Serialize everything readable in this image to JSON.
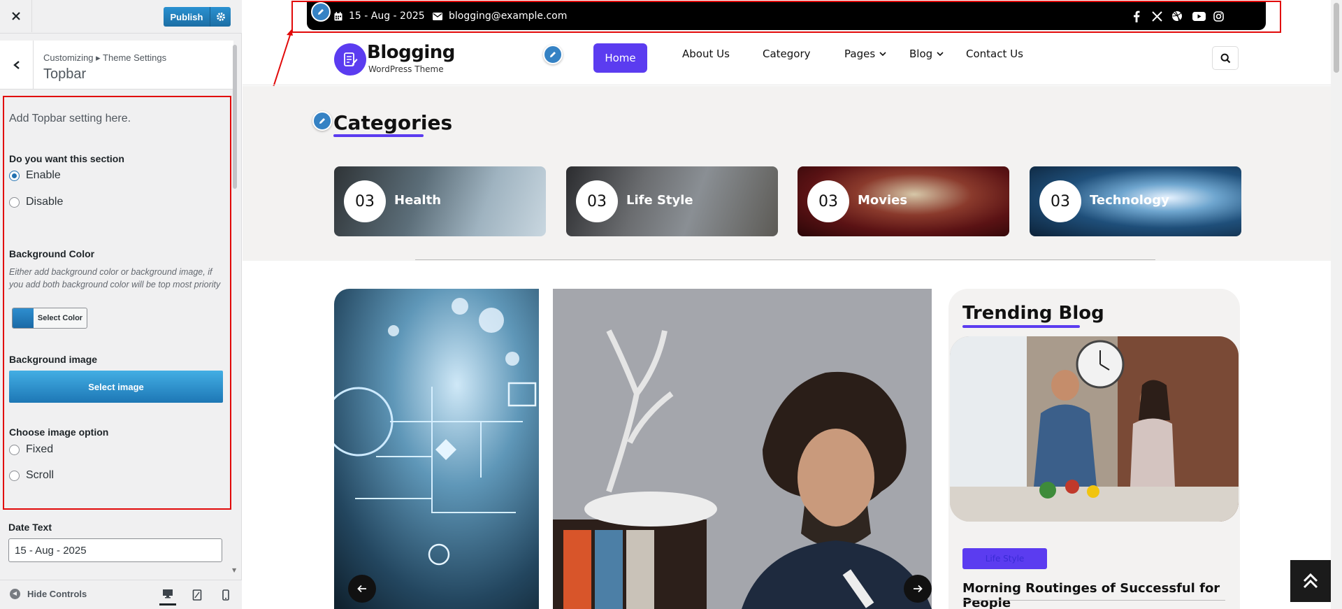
{
  "customizer": {
    "publish_label": "Publish",
    "breadcrumb": "Customizing ▸ Theme Settings",
    "section_title": "Topbar",
    "description": "Add Topbar setting here.",
    "section_toggle": {
      "label": "Do you want this section",
      "options": [
        "Enable",
        "Disable"
      ],
      "selected": "Enable"
    },
    "background_color": {
      "label": "Background Color",
      "hint": "Either add background color or background image, if you add both background color will be top most priority",
      "button_label": "Select Color",
      "swatch": "#2a8acb"
    },
    "background_image": {
      "label": "Background image",
      "button_label": "Select image"
    },
    "image_option": {
      "label": "Choose image option",
      "options": [
        "Fixed",
        "Scroll"
      ]
    },
    "date_text": {
      "label": "Date Text",
      "value": "15 - Aug - 2025"
    },
    "footer": {
      "hide_controls": "Hide Controls",
      "devices": [
        "desktop",
        "tablet",
        "mobile"
      ],
      "active_device": "desktop"
    }
  },
  "site": {
    "topbar": {
      "date": "15 - Aug - 2025",
      "email": "blogging@example.com",
      "social": [
        "facebook-icon",
        "x-icon",
        "dribbble-icon",
        "youtube-icon",
        "instagram-icon"
      ]
    },
    "logo": {
      "name": "Blogging",
      "tagline": "WordPress Theme"
    },
    "nav": {
      "home": "Home",
      "about": "About Us",
      "category": "Category",
      "pages": "Pages",
      "blog": "Blog",
      "contact": "Contact Us"
    },
    "categories": {
      "title": "Categories",
      "items": [
        {
          "count": "03",
          "name": "Health"
        },
        {
          "count": "03",
          "name": "Life Style"
        },
        {
          "count": "03",
          "name": "Movies"
        },
        {
          "count": "03",
          "name": "Technology"
        }
      ]
    },
    "trending": {
      "title": "Trending Blog",
      "badge": "Life Style",
      "post_title": "Morning Routinges of Successful for People"
    },
    "colors": {
      "accent": "#5b3cf0",
      "topbar": "#000000",
      "highlight": "#e10a0a"
    }
  }
}
